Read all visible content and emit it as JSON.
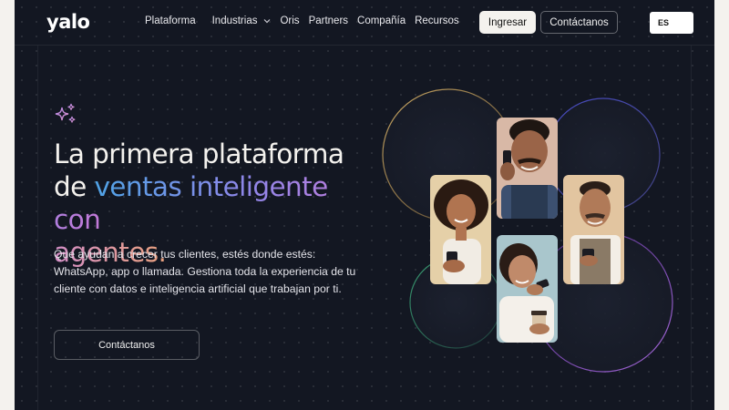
{
  "nav": {
    "logo": "yalo",
    "items": [
      {
        "label": "Plataforma"
      },
      {
        "label": "Industrias",
        "has_dropdown": true
      },
      {
        "label": "Oris"
      },
      {
        "label": "Partners"
      },
      {
        "label": "Compañía"
      },
      {
        "label": "Recursos"
      }
    ],
    "login_label": "Ingresar",
    "contact_label": "Contáctanos",
    "language": "ES"
  },
  "hero": {
    "headline_line1": "La primera plataforma",
    "headline_prefix": "de ",
    "headline_gradient_a": "ventas inteligente con",
    "headline_gradient_b": "agentes.",
    "description": "Que ayudan a crecer tus clientes, estés donde estés: WhatsApp, app o llamada. Gestiona toda la experiencia de tu cliente con datos e inteligencia artificial que trabajan por ti.",
    "cta_label": "Contáctanos"
  },
  "photos": [
    {
      "name": "woman-curly-hair-phone-photo",
      "icon": "person-photo"
    },
    {
      "name": "man-mustache-phone-call-photo",
      "icon": "person-photo"
    },
    {
      "name": "man-apron-phone-photo",
      "icon": "person-photo"
    },
    {
      "name": "woman-coffee-phone-photo",
      "icon": "person-photo"
    }
  ],
  "colors": {
    "background": "#131722",
    "page": "#f4f2ee",
    "gradient_blue": "#4fa3e6",
    "gradient_purple": "#c37ad8",
    "gradient_peach": "#e8a07c",
    "ring_gold": "#c9a45c",
    "ring_indigo": "#5a5bd6",
    "ring_green": "#3fa37a",
    "ring_violet": "#9a5ad0"
  }
}
